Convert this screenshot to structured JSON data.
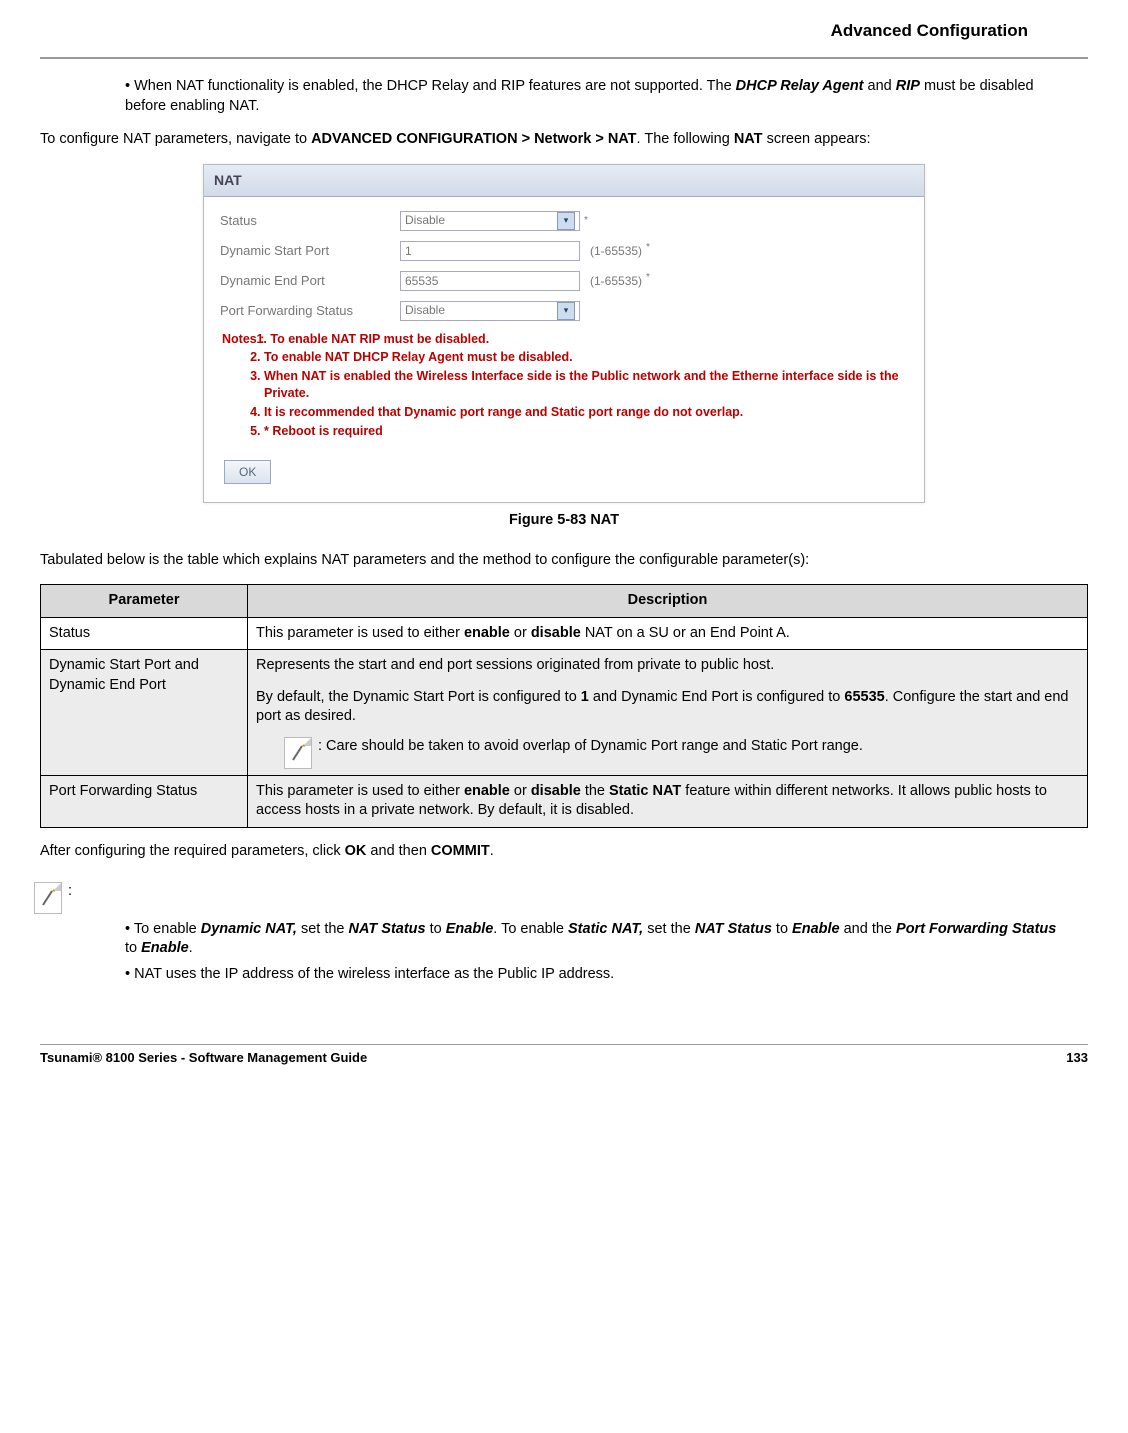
{
  "header": {
    "section": "Advanced Configuration"
  },
  "intro_bullet": {
    "prefix": "• When NAT functionality is enabled, the DHCP Relay and RIP features are not supported. The ",
    "em1": "DHCP Relay Agent",
    "mid": " and ",
    "em2": "RIP",
    "suffix": " must be disabled before enabling NAT."
  },
  "config_para": {
    "p1": "To configure NAT parameters, navigate to ",
    "path": "ADVANCED CONFIGURATION > Network > NAT",
    "p2": ". The following ",
    "nat": "NAT",
    "p3": " screen appears:"
  },
  "shot": {
    "title": "NAT",
    "rows": {
      "status_label": "Status",
      "status_value": "Disable",
      "dyn_start_label": "Dynamic Start Port",
      "dyn_start_value": "1",
      "dyn_start_range": "(1-65535)",
      "dyn_end_label": "Dynamic End Port",
      "dyn_end_value": "65535",
      "dyn_end_range": "(1-65535)",
      "pfs_label": "Port Forwarding Status",
      "pfs_value": "Disable"
    },
    "notes_label": "Notes :",
    "notes": [
      "To enable NAT RIP must be disabled.",
      "To enable NAT DHCP Relay Agent must be disabled.",
      "When NAT is enabled the Wireless Interface side is the Public network and the Etherne interface side is the Private.",
      "It is recommended that Dynamic port range and Static port range do not overlap.",
      "* Reboot is required"
    ],
    "ok": "OK"
  },
  "figure_caption": "Figure 5-83 NAT",
  "table_intro": "Tabulated below is the table which explains NAT parameters and the method to configure the configurable parameter(s):",
  "table": {
    "head_param": "Parameter",
    "head_desc": "Description",
    "r1": {
      "param": "Status",
      "d1": "This parameter is used to either ",
      "b1": "enable",
      "d2": " or ",
      "b2": "disable",
      "d3": " NAT on a SU or an End Point A."
    },
    "r2": {
      "param": "Dynamic Start Port and Dynamic End Port",
      "d1": "Represents the start and end port sessions originated from private to public host.",
      "d2a": "By default, the Dynamic Start Port is configured to ",
      "b1": "1",
      "d2b": " and Dynamic End Port is configured to ",
      "b2": "65535",
      "d2c": ". Configure the start and end port as desired.",
      "note": ": Care should be taken to avoid overlap of Dynamic Port range and Static Port range."
    },
    "r3": {
      "param": "Port Forwarding Status",
      "d1": "This parameter is used to either ",
      "b1": "enable",
      "d2": " or ",
      "b2": "disable",
      "d3": " the ",
      "b3": "Static NAT",
      "d4": " feature within different networks. It allows public hosts to access hosts in a private network. By default, it is disabled."
    }
  },
  "after_table": {
    "p1": "After configuring the required parameters, click ",
    "b1": "OK",
    "p2": " and then ",
    "b2": "COMMIT",
    "p3": "."
  },
  "bottom_notes": {
    "n1": {
      "a": "• To enable ",
      "e1": "Dynamic NAT,",
      "b": " set the ",
      "e2": "NAT Status",
      "c": " to ",
      "e3": "Enable",
      "d": ". To enable ",
      "e4": "Static NAT,",
      "e": " set the ",
      "e5": "NAT Status",
      "f": " to ",
      "e6": "Enable",
      "g": " and the ",
      "e7": "Port Forwarding Status",
      "h": " to ",
      "e8": "Enable",
      "i": "."
    },
    "n2": "• NAT uses the IP address of the wireless interface as the Public IP address."
  },
  "footer": {
    "left": "Tsunami® 8100 Series - Software Management Guide",
    "right": "133"
  }
}
